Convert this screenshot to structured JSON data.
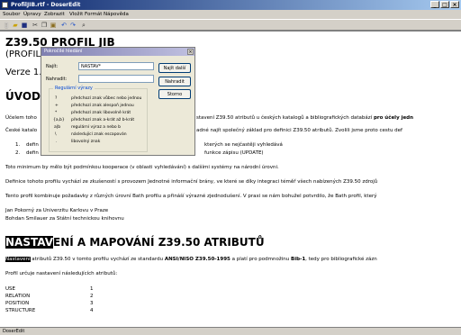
{
  "window": {
    "title": "ProfilJIB.rtf - DoserEdit"
  },
  "menu": [
    "Soubor",
    "Úpravy",
    "Zobrazit",
    "Vložit",
    "Formát",
    "Nápověda"
  ],
  "document": {
    "title": "Z39.50 PROFIL JIB",
    "subtitle": "(PROFIL",
    "version": "Verze 1.",
    "section1": "ÚVOD",
    "p1_a": "Účelem toho",
    "p1_b": "stavení Z39.50 atributů u českých katalogů a bibliografických databází",
    "p1_bold": "pro účely jedn",
    "p2_a": "České katalo",
    "p2_b": "adné najít společný základ pro definici Z39.50 atributů. Zvolili jsme proto  cestu def",
    "li1_num": "1.",
    "li1_a": "defin",
    "li1_b": "kterých se nejčastěji vyhledává",
    "li2_num": "2.",
    "li2_a": "defin",
    "li2_b": "funkce zápisu (UPDATE)",
    "p3": "Toto minimum by mělo být podmínkou kooperace (v oblasti vyhledávání) s dalšími systémy na národní úrovni.",
    "p4": "Definice tohoto profilu vychází ze zkušeností s provozem Jednotné informační brány, ve které se díky integraci téměř všech nabízených Z39.50 zdrojů",
    "p5": "Tento profil kombinuje požadavky z různých úrovní Bath profilu a přináší výrazné zjednodušení. V praxi se nám bohužel potvrdilo, že Bath profil, který",
    "author1": "Jan Pokorný za Univerzitu Karlovu v Praze",
    "author2": "Bohdan Smilauer za Státní technickou knihovnu",
    "section2_hl": "NASTAV",
    "section2_rest": "ENÍ A MAPOVÁNÍ Z39.50 ATRIBUTŮ",
    "p6_hl": "Nastavení",
    "p6_a": " atributů Z39.50 v tomto profilu vychází ze standardu ",
    "p6_bold1": "ANSI/NISO Z39.50-1995",
    "p6_b": " a platí pro podmnožinu ",
    "p6_bold2": "Bib-1",
    "p6_c": ", tedy pro bibliografické zázn",
    "p7": "Profil určuje nastavení následujících atributů:",
    "attrs": [
      {
        "name": "USE",
        "val": "1"
      },
      {
        "name": "RELATION",
        "val": "2"
      },
      {
        "name": "POSITION",
        "val": "3"
      },
      {
        "name": "STRUCTURE",
        "val": "4"
      }
    ]
  },
  "dialog": {
    "title": "Pokročilé hledání",
    "find_label": "Najít:",
    "find_value": "NASTAV*",
    "replace_label": "Nahradit:",
    "replace_value": "",
    "btn_find_next": "Najít další",
    "btn_replace": "Nahradit",
    "btn_cancel": "Storno",
    "group_title": "Regulární výrazy",
    "regex": [
      {
        "sym": "?",
        "desc": "předchozí znak vůbec nebo jednou"
      },
      {
        "sym": "+",
        "desc": "předchozí znak alespoň jednou"
      },
      {
        "sym": "*",
        "desc": "předchozí znak libovolně krát"
      },
      {
        "sym": "{a,b}",
        "desc": "předchozí znak a-krát až b-krát"
      },
      {
        "sym": "a|b",
        "desc": "regulární výraz a nebo b"
      },
      {
        "sym": "\\",
        "desc": "následující znak escapován"
      },
      {
        "sym": ".",
        "desc": "libovolný znak"
      }
    ]
  },
  "statusbar": {
    "text": "DoserEdit"
  }
}
